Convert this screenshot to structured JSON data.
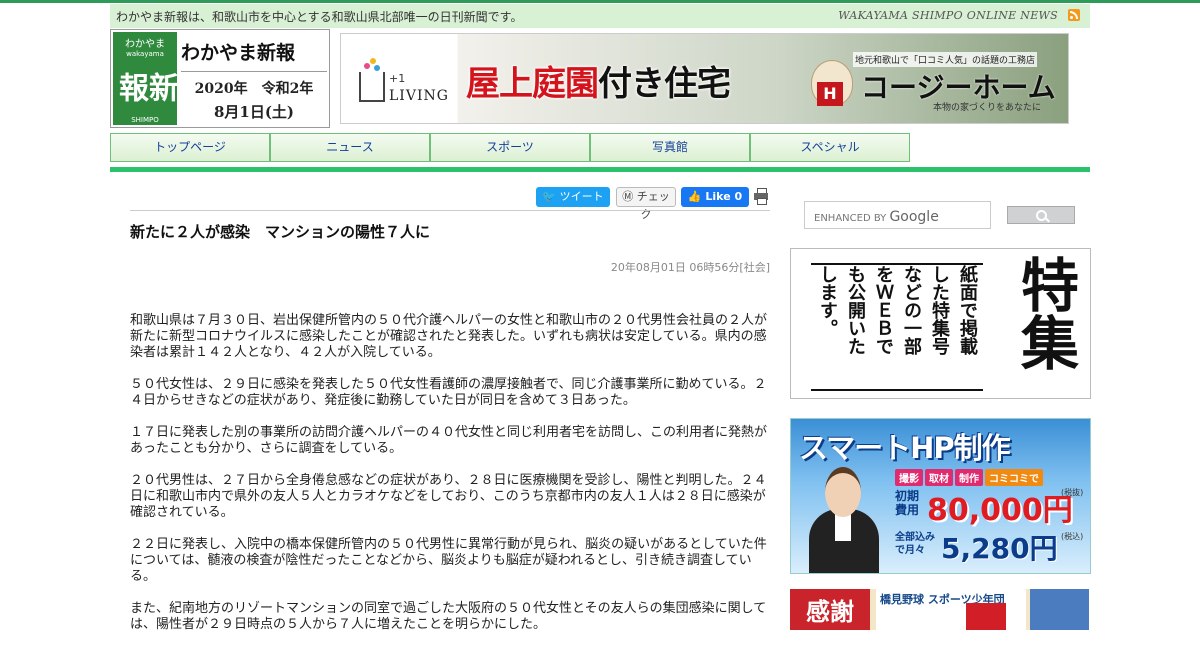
{
  "header": {
    "tagline": "わかやま新報は、和歌山市を中心とする和歌山県北部唯一の日刊新聞です。",
    "brand_en": "WAKAYAMA SHIMPO ONLINE NEWS"
  },
  "logo": {
    "kana": "わかやま",
    "big": "新報",
    "romaji_small": "wakayama",
    "shimpo_small": "SHIMPO",
    "name": "わかやま新報",
    "year": "2020年　令和2年",
    "date": "8月1日(土)"
  },
  "banner": {
    "living_plus": "+1",
    "living_word": "LIVING",
    "headline_red": "屋上庭園",
    "headline_black": "付き住宅",
    "sub": "地元和歌山で「口コミ人気」の話題の工務店",
    "brand": "コージーホーム",
    "tag": "本物の家づくりをあなたに",
    "logo_letter": "H"
  },
  "nav": {
    "items": [
      "トップページ",
      "ニュース",
      "スポーツ",
      "写真館",
      "スペシャル"
    ]
  },
  "share": {
    "tweet": "ツイート",
    "check": "チェック",
    "like": "Like 0"
  },
  "article": {
    "title": "新たに２人が感染　マンションの陽性７人に",
    "meta": "20年08月01日 06時56分[社会]",
    "paragraphs": [
      "和歌山県は７月３０日、岩出保健所管内の５０代介護ヘルパーの女性と和歌山市の２０代男性会社員の２人が新たに新型コロナウイルスに感染したことが確認されたと発表した。いずれも病状は安定している。県内の感染者は累計１４２人となり、４２人が入院している。",
      "５０代女性は、２９日に感染を発表した５０代女性看護師の濃厚接触者で、同じ介護事業所に勤めている。２４日からせきなどの症状があり、発症後に勤務していた日が同日を含めて３日あった。",
      "１７日に発表した別の事業所の訪問介護ヘルパーの４０代女性と同じ利用者宅を訪問し、この利用者に発熱があったことも分かり、さらに調査をしている。",
      "２０代男性は、２７日から全身倦怠感などの症状があり、２８日に医療機関を受診し、陽性と判明した。２４日に和歌山市内で県外の友人５人とカラオケなどをしており、このうち京都市内の友人１人は２８日に感染が確認されている。",
      "２２日に発表し、入院中の橋本保健所管内の５０代男性に異常行動が見られ、脳炎の疑いがあるとしていた件については、髄液の検査が陰性だったことなどから、脳炎よりも脳症が疑われるとし、引き続き調査している。",
      "また、紀南地方のリゾートマンションの同室で過ごした大阪府の５０代女性とその友人らの集団感染に関しては、陽性者が２９日時点の５人から７人に増えたことを明らかにした。"
    ]
  },
  "search": {
    "placeholder_prefix": "ENHANCED BY",
    "placeholder_brand": "Google"
  },
  "ad_special": {
    "big": "特集",
    "lines": [
      "紙面で掲載",
      "した特集号",
      "などの一部",
      "をＷＥＢで",
      "も公開いた",
      "します。"
    ]
  },
  "ad_hp": {
    "headline": "スマートHP制作",
    "tags": [
      "撮影",
      "取材",
      "制作",
      "コミコミで"
    ],
    "label1a": "初期",
    "label1b": "費用",
    "price1": "80,000円",
    "tax1": "(税抜)",
    "label2": "全部込みで月々",
    "price2": "5,280円",
    "tax2": "(税込)"
  },
  "ad_sports": {
    "left": "感謝",
    "mid": "橋見野球 スポーツ少年団"
  },
  "colors": {
    "accent_green": "#2cc26b",
    "nav_text": "#173f9b",
    "twitter": "#1da1f2",
    "facebook": "#1877f2",
    "banner_red": "#d3141c"
  }
}
